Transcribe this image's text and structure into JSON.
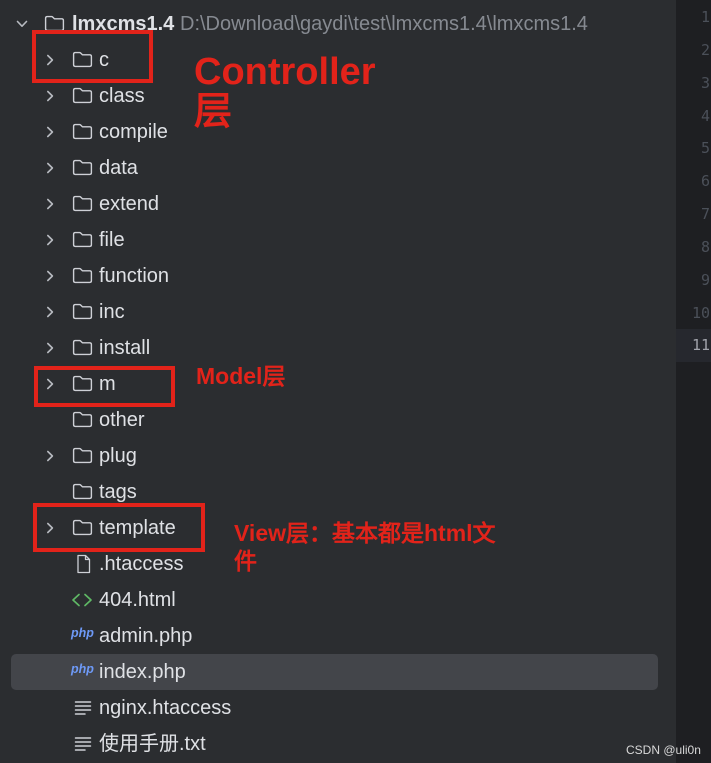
{
  "theme": {
    "panel_bg": "#2b2d30",
    "gutter_bg": "#1e1f22",
    "text": "#dfe1e5",
    "path_text": "#868a91",
    "selection_bg": "#43454a",
    "folder_icon": "#ced0d6",
    "html_icon": "#5fb865",
    "php_icon": "#6e9af8",
    "annotation_red": "#e2231a"
  },
  "project": {
    "name": "lmxcms1.4",
    "path": "D:\\Download\\gaydi\\test\\lmxcms1.4\\lmxcms1.4",
    "icon": "folder-icon",
    "chevron": "chevron-down-icon"
  },
  "icons": {
    "php_glyph": "php"
  },
  "tree": {
    "items": [
      {
        "label": "c",
        "icon": "folder-icon",
        "chevron": "chevron-right-icon"
      },
      {
        "label": "class",
        "icon": "folder-icon",
        "chevron": "chevron-right-icon"
      },
      {
        "label": "compile",
        "icon": "folder-icon",
        "chevron": "chevron-right-icon"
      },
      {
        "label": "data",
        "icon": "folder-icon",
        "chevron": "chevron-right-icon"
      },
      {
        "label": "extend",
        "icon": "folder-icon",
        "chevron": "chevron-right-icon"
      },
      {
        "label": "file",
        "icon": "folder-icon",
        "chevron": "chevron-right-icon"
      },
      {
        "label": "function",
        "icon": "folder-icon",
        "chevron": "chevron-right-icon"
      },
      {
        "label": "inc",
        "icon": "folder-icon",
        "chevron": "chevron-right-icon"
      },
      {
        "label": "install",
        "icon": "folder-icon",
        "chevron": "chevron-right-icon"
      },
      {
        "label": "m",
        "icon": "folder-icon",
        "chevron": "chevron-right-icon"
      },
      {
        "label": "other",
        "icon": "folder-icon"
      },
      {
        "label": "plug",
        "icon": "folder-icon",
        "chevron": "chevron-right-icon"
      },
      {
        "label": "tags",
        "icon": "folder-icon"
      },
      {
        "label": "template",
        "icon": "folder-icon",
        "chevron": "chevron-right-icon"
      },
      {
        "label": ".htaccess",
        "icon": "htaccess-file-icon"
      },
      {
        "label": "404.html",
        "icon": "html-file-icon"
      },
      {
        "label": "admin.php",
        "icon": "php-file-icon"
      },
      {
        "label": "index.php",
        "icon": "php-file-icon",
        "selected": true
      },
      {
        "label": "nginx.htaccess",
        "icon": "text-file-icon"
      },
      {
        "label": "使用手册.txt",
        "icon": "text-file-icon"
      }
    ]
  },
  "gutter": {
    "line_numbers": [
      "1",
      "2",
      "3",
      "4",
      "5",
      "6",
      "7",
      "8",
      "9",
      "10",
      "11"
    ],
    "current_line": 11
  },
  "annotations": {
    "controller_label": "Controller层",
    "model_label": "Model层",
    "view_label": "View层：基本都是html文件"
  },
  "watermark": "CSDN @uli0n"
}
